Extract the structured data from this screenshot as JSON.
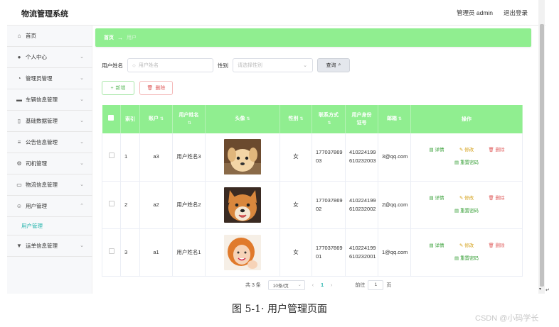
{
  "header": {
    "app_title": "物流管理系统",
    "user_label": "管理员 admin",
    "logout_label": "退出登录"
  },
  "sidebar": {
    "items": [
      {
        "label": "首页",
        "icon": "home-icon",
        "has_chevron": false
      },
      {
        "label": "个人中心",
        "icon": "user-icon",
        "has_chevron": true
      },
      {
        "label": "管理员管理",
        "icon": "clock-icon",
        "has_chevron": true
      },
      {
        "label": "车辆信息管理",
        "icon": "monitor-icon",
        "has_chevron": true
      },
      {
        "label": "基础数据管理",
        "icon": "phone-icon",
        "has_chevron": true
      },
      {
        "label": "公告信息管理",
        "icon": "list-icon",
        "has_chevron": true
      },
      {
        "label": "司机管理",
        "icon": "gear-icon",
        "has_chevron": true
      },
      {
        "label": "物流信息管理",
        "icon": "chat-icon",
        "has_chevron": true
      },
      {
        "label": "用户管理",
        "icon": "user-group-icon",
        "has_chevron": true,
        "expanded": true
      },
      {
        "label": "运单信息管理",
        "icon": "stamp-icon",
        "has_chevron": true
      }
    ],
    "sub_item": "用户管理"
  },
  "breadcrumb": {
    "home": "首页",
    "separator": "→",
    "current": "用户"
  },
  "search": {
    "name_label": "用户姓名",
    "name_placeholder": "用户姓名",
    "gender_label": "性别",
    "gender_placeholder": "请选择性别",
    "search_button": "查询"
  },
  "actions": {
    "add": "新增",
    "delete": "删除"
  },
  "table": {
    "headers": [
      "索引",
      "账户",
      "用户姓名",
      "头像",
      "性别",
      "联系方式",
      "用户身份证号",
      "邮箱",
      "操作"
    ],
    "rows": [
      {
        "index": "1",
        "account": "a3",
        "name": "用户姓名3",
        "avatar": "puppy-photo",
        "gender": "女",
        "phone": "17703786903",
        "id_card": "410224199610232003",
        "email": "3@qq.com"
      },
      {
        "index": "2",
        "account": "a2",
        "name": "用户姓名2",
        "avatar": "shiba-photo",
        "gender": "女",
        "phone": "17703786902",
        "id_card": "410224199610232002",
        "email": "2@qq.com"
      },
      {
        "index": "3",
        "account": "a1",
        "name": "用户姓名1",
        "avatar": "woman-photo",
        "gender": "女",
        "phone": "17703786901",
        "id_card": "410224199610232001",
        "email": "1@qq.com"
      }
    ],
    "ops": {
      "detail": "详情",
      "edit": "修改",
      "delete": "删除",
      "reset": "重置密码"
    }
  },
  "pager": {
    "total": "共 3 条",
    "page_size": "10条/页",
    "current_page": "1",
    "goto_label": "前往",
    "goto_value": "1",
    "page_unit": "页"
  },
  "caption": "图 5-1· 用户管理页面",
  "watermark": "CSDN @小码学长",
  "colors": {
    "accent_green": "#90ee90",
    "link_teal": "#20b2aa",
    "delete_red": "#e06060",
    "edit_gold": "#d4a017"
  }
}
